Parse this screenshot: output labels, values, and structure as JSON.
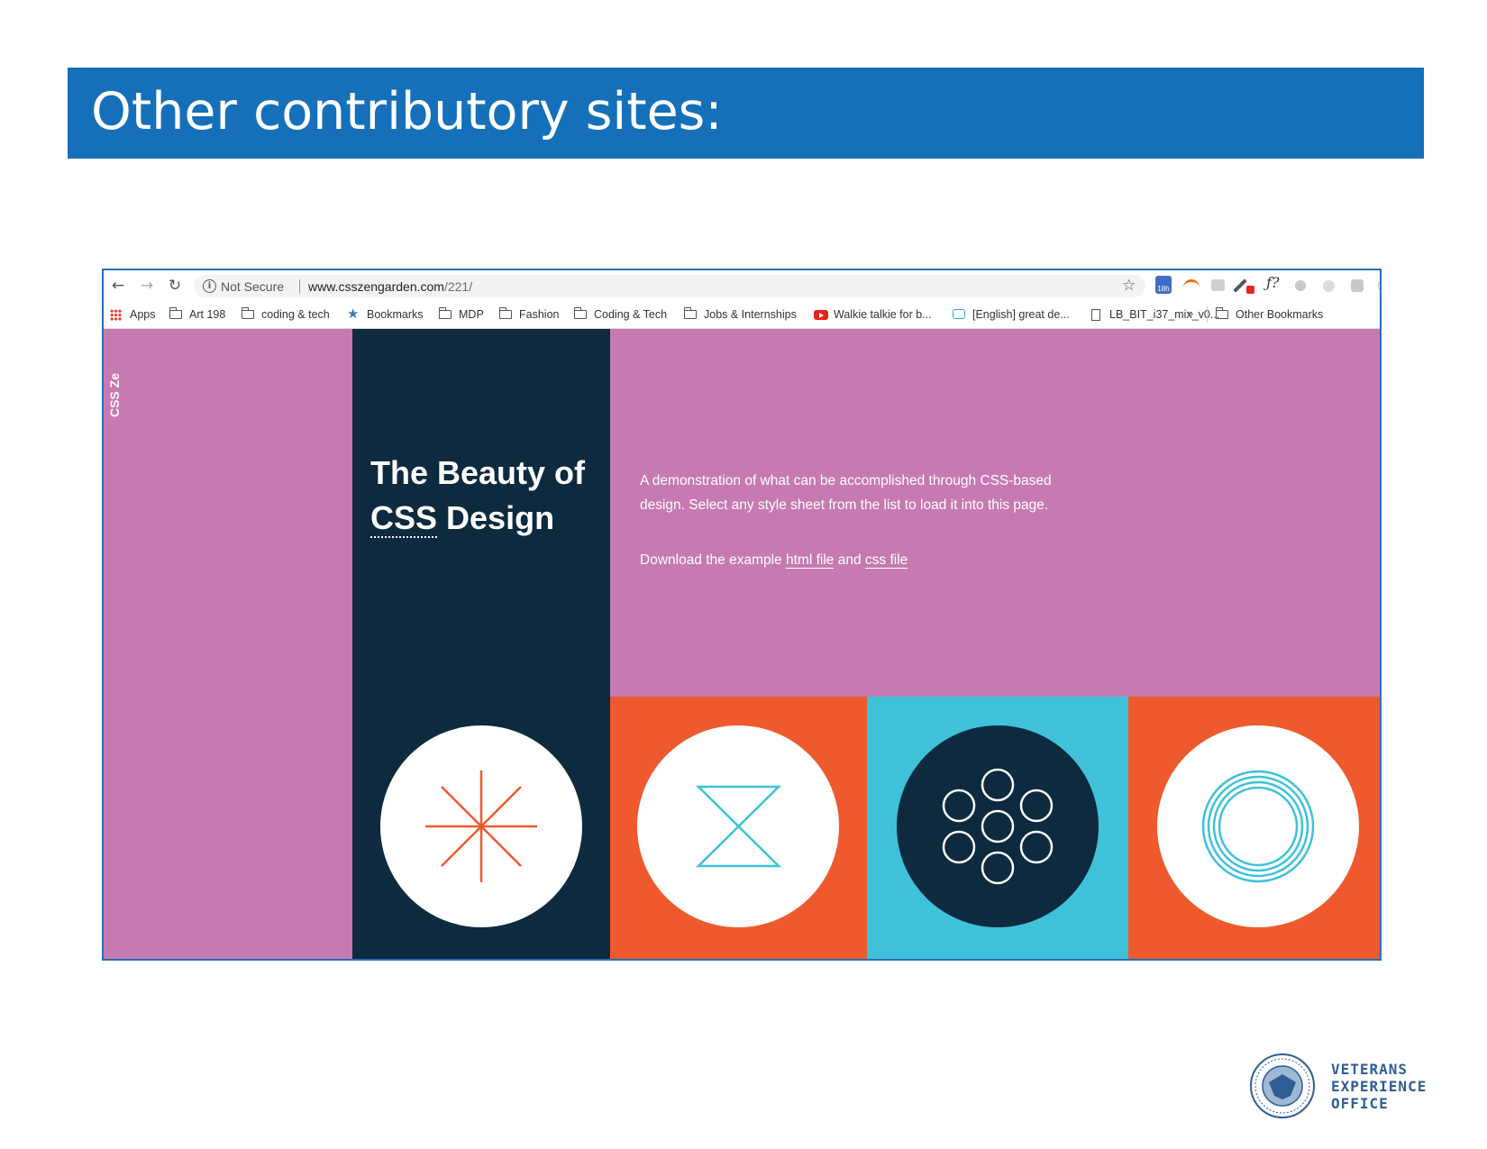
{
  "slide": {
    "title": "Other contributory sites:",
    "logo_text": [
      "VETERANS",
      "EXPERIENCE",
      "OFFICE"
    ]
  },
  "browser": {
    "security_label": "Not Secure",
    "url_host": "www.csszengarden.com",
    "url_path": "/221/",
    "bookmarks": [
      {
        "icon": "apps-icon",
        "label": "Apps"
      },
      {
        "icon": "folder-icon",
        "label": "Art 198"
      },
      {
        "icon": "folder-icon",
        "label": "coding & tech"
      },
      {
        "icon": "star-icon",
        "label": "Bookmarks"
      },
      {
        "icon": "folder-icon",
        "label": "MDP"
      },
      {
        "icon": "folder-icon",
        "label": "Fashion"
      },
      {
        "icon": "folder-icon",
        "label": "Coding & Tech"
      },
      {
        "icon": "folder-icon",
        "label": "Jobs & Internships"
      },
      {
        "icon": "youtube-icon",
        "label": "Walkie talkie for b..."
      },
      {
        "icon": "bilibili-icon",
        "label": "[English] great de..."
      },
      {
        "icon": "document-icon",
        "label": "LB_BIT_i37_mix_v0..."
      },
      {
        "icon": "folder-icon",
        "label": "Other Bookmarks"
      }
    ],
    "overflow_label": "»",
    "extension_badge": "18h"
  },
  "page": {
    "side_tab": "CSS Ze",
    "hero_title_part1": "The Beauty of",
    "hero_title_abbr": "CSS",
    "hero_title_part2": " Design",
    "intro": "A demonstration of what can be accomplished through CSS-based design. Select any style sheet from the list to load it into this page.",
    "download_prefix": "Download the example ",
    "html_link": "html file",
    "download_and": " and ",
    "css_link": "css file"
  },
  "colors": {
    "header_blue": "#1570b9",
    "zen_pink": "#c67ab1",
    "zen_navy": "#0d2a3e",
    "zen_orange": "#ee5a2e",
    "zen_cyan": "#3ec1d9"
  },
  "tiles": [
    {
      "motif": "asterisk-icon"
    },
    {
      "motif": "hourglass-icon"
    },
    {
      "motif": "seven-circles-icon"
    },
    {
      "motif": "concentric-rings-icon"
    }
  ]
}
